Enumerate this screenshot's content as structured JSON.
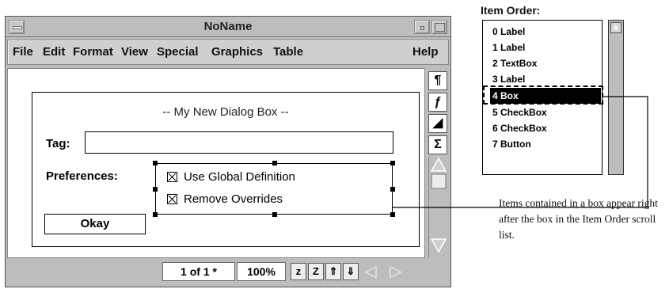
{
  "window": {
    "title": "NoName",
    "menu": [
      "File",
      "Edit",
      "Format",
      "View",
      "Special",
      "Graphics",
      "Table",
      "Help"
    ]
  },
  "toolbar_side": {
    "icons": [
      "pilcrow-icon",
      "function-icon",
      "triangle-ruler-icon",
      "sigma-icon"
    ],
    "glyphs": [
      "¶",
      "ƒ",
      "◢",
      "Σ"
    ]
  },
  "dialog": {
    "title": "-- My New Dialog Box --",
    "tag_label": "Tag:",
    "tag_value": "",
    "preferences_label": "Preferences:",
    "checkboxes": [
      "Use Global Definition",
      "Remove Overrides"
    ],
    "ok_button": "Okay"
  },
  "statusbar": {
    "page": "1 of 1 *",
    "zoom": "100%",
    "icons": [
      "zoom-out-icon",
      "zoom-in-icon",
      "page-up-icon",
      "page-down-icon",
      "scroll-left-icon",
      "scroll-right-icon"
    ],
    "glyphs": [
      "z",
      "Z",
      "⇑",
      "⇓",
      "◁",
      "▷"
    ]
  },
  "item_order": {
    "title": "Item Order:",
    "items": [
      "0 Label",
      "1 Label",
      "2 TextBox",
      "3 Label",
      "4 Box",
      "5 CheckBox",
      "6 CheckBox",
      "7 Button"
    ],
    "selected_index": 4
  },
  "annotation": {
    "text": "Items contained in a box appear right after the box in the Item Order scroll list."
  }
}
